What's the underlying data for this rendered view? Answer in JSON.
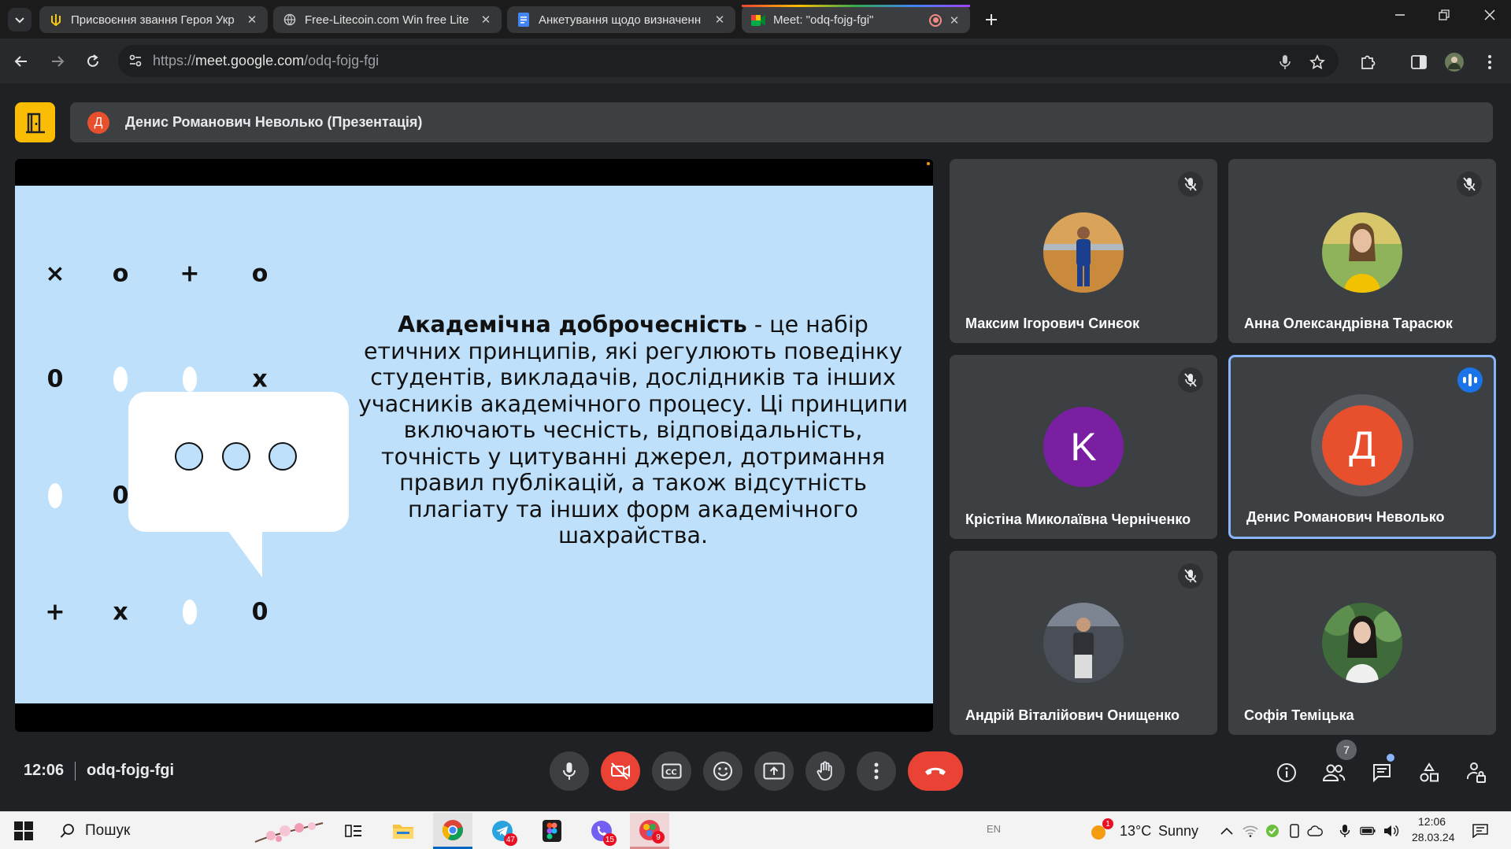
{
  "browser": {
    "tabs": [
      {
        "title": "Присвоєння звання Героя Укр",
        "icon": "ukraine-trident-icon"
      },
      {
        "title": "Free-Litecoin.com Win free Lite",
        "icon": "globe-icon"
      },
      {
        "title": "Анкетування щодо визначенн",
        "icon": "google-forms-icon"
      },
      {
        "title": "Meet: \"odq-fojg-fgi\"",
        "icon": "google-meet-icon",
        "active": true
      }
    ],
    "url_scheme": "https://",
    "url_host": "meet.google.com",
    "url_path": "/odq-fojg-fgi"
  },
  "meet": {
    "presenter_initial": "Д",
    "presenter_title": "Денис Романович Неволько (Презентація)",
    "slide": {
      "heading": "Академічна доброчесність",
      "body": " - це набір етичних принципів, які регулюють поведінку студентів, викладачів, дослідників та інших учасників академічного процесу. Ці принципи включають чесність, відповідальність, точність у цитуванні джерел, дотримання правил публікацій, а також відсутність плагіату та інших форм академічного шахрайства.",
      "symbols": [
        "×",
        "o",
        "+",
        "o",
        "0",
        "x",
        "0",
        "0",
        "+",
        "x",
        "0"
      ]
    },
    "participants": [
      {
        "name": "Максим Ігорович Синєок",
        "muted": true,
        "avatar": "photo"
      },
      {
        "name": "Анна Олександрівна Тарасюк",
        "muted": true,
        "avatar": "photo"
      },
      {
        "name": "Крістіна Миколаївна Черніченко",
        "muted": true,
        "avatar": "letter",
        "initial": "K",
        "color": "#7b1fa2"
      },
      {
        "name": "Денис Романович Неволько",
        "muted": false,
        "speaking": true,
        "avatar": "letter",
        "initial": "Д",
        "color": "#e8502d"
      },
      {
        "name": "Андрій Віталійович Онищенко",
        "muted": true,
        "avatar": "photo"
      },
      {
        "name": "Софія Теміцька",
        "muted": false,
        "avatar": "photo"
      }
    ],
    "clock": "12:06",
    "meeting_code": "odq-fojg-fgi",
    "people_count": "7"
  },
  "taskbar": {
    "search_label": "Пошук",
    "telegram_badge": "47",
    "viber_badge": "15",
    "app_badge": "9",
    "lang": "EN",
    "weather_temp": "13°C",
    "weather_text": "Sunny",
    "weather_alert": "1",
    "time": "12:06",
    "date": "28.03.24"
  }
}
